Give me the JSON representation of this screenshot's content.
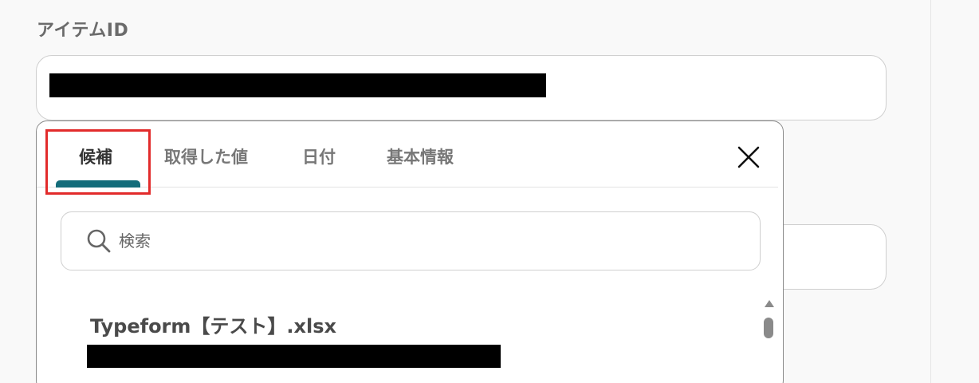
{
  "field": {
    "label": "アイテムID"
  },
  "popup": {
    "tabs": [
      {
        "label": "候補"
      },
      {
        "label": "取得した値"
      },
      {
        "label": "日付"
      },
      {
        "label": "基本情報"
      }
    ],
    "active_tab": "候補",
    "close_icon": "close-icon",
    "search": {
      "placeholder": "検索",
      "value": "",
      "icon": "search-icon"
    },
    "items": [
      {
        "title": "Typeform【テスト】.xlsx"
      }
    ]
  },
  "colors": {
    "accent": "#136c7a",
    "highlight": "#e22b2b",
    "redaction": "#000000"
  }
}
